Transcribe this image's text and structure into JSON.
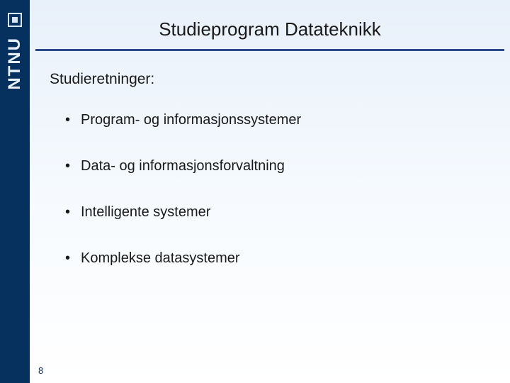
{
  "sidebar": {
    "brand": "NTNU"
  },
  "title": "Studieprogram Datateknikk",
  "subheading": "Studieretninger:",
  "bullets": [
    "Program- og informasjonssystemer",
    "Data- og informasjonsforvaltning",
    "Intelligente systemer",
    "Komplekse datasystemer"
  ],
  "page_number": "8"
}
